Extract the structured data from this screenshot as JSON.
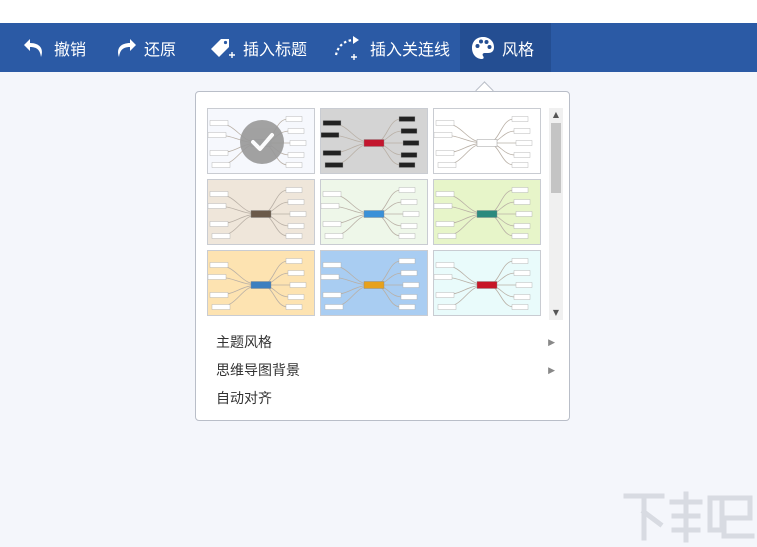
{
  "toolbar": {
    "undo_label": "撤销",
    "redo_label": "还原",
    "insert_title_label": "插入标题",
    "insert_connector_label": "插入关连线",
    "style_label": "风格"
  },
  "style_menu": {
    "items": [
      {
        "label": "主题风格",
        "has_submenu": true
      },
      {
        "label": "思维导图背景",
        "has_submenu": true
      },
      {
        "label": "自动对齐",
        "has_submenu": false
      }
    ]
  },
  "themes": [
    {
      "name": "theme-1",
      "bg": "#f6f8fd",
      "center": "#d7dbe6",
      "selected": true
    },
    {
      "name": "theme-2",
      "bg": "#d4d4d4",
      "center": "#c3162e",
      "selected": false
    },
    {
      "name": "theme-3",
      "bg": "#ffffff",
      "center": "#ffffff",
      "selected": false
    },
    {
      "name": "theme-4",
      "bg": "#efe6da",
      "center": "#6b5a4a",
      "selected": false
    },
    {
      "name": "theme-5",
      "bg": "#eef7e9",
      "center": "#3a90d8",
      "selected": false
    },
    {
      "name": "theme-6",
      "bg": "#e7f5c9",
      "center": "#2b8a7e",
      "selected": false
    },
    {
      "name": "theme-7",
      "bg": "#fde3b1",
      "center": "#3c7fbf",
      "selected": false
    },
    {
      "name": "theme-8",
      "bg": "#a9cdf2",
      "center": "#e7a11b",
      "selected": false
    },
    {
      "name": "theme-9",
      "bg": "#e9fbfb",
      "center": "#c71526",
      "selected": false
    }
  ],
  "colors": {
    "toolbar_bg": "#2b5aa5",
    "toolbar_active_bg": "#244e92"
  }
}
